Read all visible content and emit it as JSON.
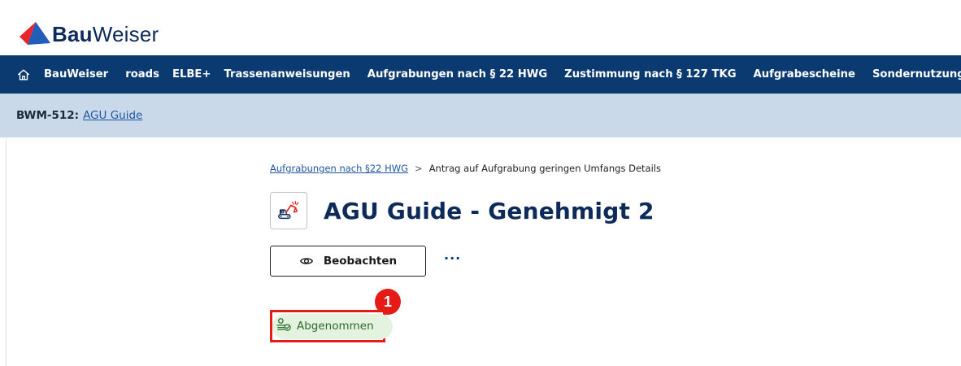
{
  "app": {
    "logo_bold": "Bau",
    "logo_regular": "Weiser"
  },
  "nav": {
    "items": [
      {
        "label": "BauWeiser"
      },
      {
        "label": "roads"
      },
      {
        "label": "ELBE+"
      },
      {
        "label": "Trassenanweisungen"
      },
      {
        "label": "Aufgrabungen nach § 22 HWG"
      },
      {
        "label": "Zustimmung nach § 127 TKG"
      },
      {
        "label": "Aufgrabescheine"
      },
      {
        "label": "Sondernutzungen"
      }
    ]
  },
  "context": {
    "key": "BWM-512:",
    "link": "AGU Guide"
  },
  "breadcrumb": {
    "parent": "Aufgrabungen nach §22 HWG",
    "separator": ">",
    "current": "Antrag auf Aufgrabung geringen Umfangs Details"
  },
  "page": {
    "title": "AGU Guide - Genehmigt 2"
  },
  "actions": {
    "watch_label": "Beobachten",
    "more_label": "···"
  },
  "status": {
    "label": "Abgenommen"
  },
  "annotation": {
    "marker_number": "1"
  },
  "colors": {
    "nav_bg": "#0b3a70",
    "context_bg": "#c9d9ea",
    "title": "#0d2b5a",
    "link": "#1f57a3",
    "status_bg": "#e4f2e0",
    "status_text": "#2c6b2a",
    "highlight": "#e41b17"
  },
  "icons": {
    "home": "home-icon",
    "title": "excavator-icon",
    "watch": "eye-icon",
    "status": "inspection-approved-icon"
  }
}
